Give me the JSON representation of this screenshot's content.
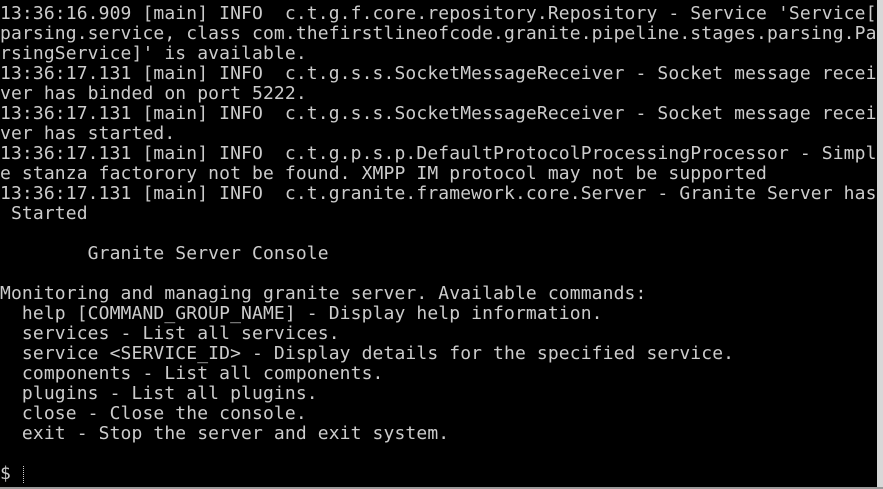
{
  "terminal": {
    "lines": [
      "13:36:16.909 [main] INFO  c.t.g.f.core.repository.Repository - Service 'Service[",
      "parsing.service, class com.thefirstlineofcode.granite.pipeline.stages.parsing.Pa",
      "rsingService]' is available.",
      "13:36:17.131 [main] INFO  c.t.g.s.s.SocketMessageReceiver - Socket message recei",
      "ver has binded on port 5222.",
      "13:36:17.131 [main] INFO  c.t.g.s.s.SocketMessageReceiver - Socket message recei",
      "ver has started.",
      "13:36:17.131 [main] INFO  c.t.g.p.s.p.DefaultProtocolProcessingProcessor - Simpl",
      "e stanza factorory not be found. XMPP IM protocol may not be supported",
      "13:36:17.131 [main] INFO  c.t.granite.framework.core.Server - Granite Server has",
      " Started",
      "",
      "        Granite Server Console",
      "",
      "Monitoring and managing granite server. Available commands:",
      "  help [COMMAND_GROUP_NAME] - Display help information.",
      "  services - List all services.",
      "  service <SERVICE_ID> - Display details for the specified service.",
      "  components - List all components.",
      "  plugins - List all plugins.",
      "  close - Close the console.",
      "  exit - Stop the server and exit system.",
      ""
    ],
    "prompt": "$"
  }
}
